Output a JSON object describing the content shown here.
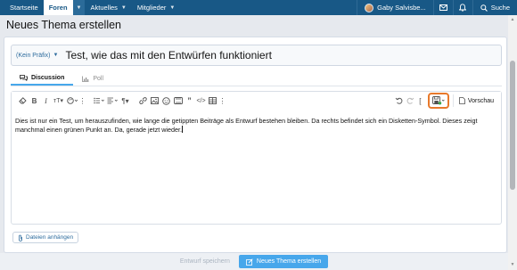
{
  "nav": {
    "items": [
      {
        "label": "Startseite"
      },
      {
        "label": "Foren"
      },
      {
        "label": "Aktuelles"
      },
      {
        "label": "Mitglieder"
      }
    ],
    "user_name": "Gaby Salvisbe...",
    "search_label": "Suche"
  },
  "page": {
    "title": "Neues Thema erstellen"
  },
  "form": {
    "prefix": "(Kein Präfix)",
    "title_value": "Test, wie das mit den Entwürfen funktioniert",
    "tabs": [
      {
        "label": "Discussion",
        "active": true
      },
      {
        "label": "Poll",
        "active": false
      }
    ]
  },
  "editor": {
    "preview_label": "Vorschau",
    "content": "Dies ist nur ein Test, um herauszufinden, wie lange die getippten Beiträge als Entwurf bestehen bleiben. Da rechts befindet sich ein Disketten-Symbol. Dieses zeigt manchmal einen grünen Punkt an. Da, gerade jetzt wieder."
  },
  "attach_label": "Dateien anhängen",
  "footer": {
    "save_draft_label": "Entwurf speichern",
    "submit_label": "Neues Thema erstellen"
  },
  "colors": {
    "nav_bg": "#185886",
    "accent": "#47a7eb",
    "highlight": "#e8792b",
    "draft_dot": "#3aa64b"
  }
}
